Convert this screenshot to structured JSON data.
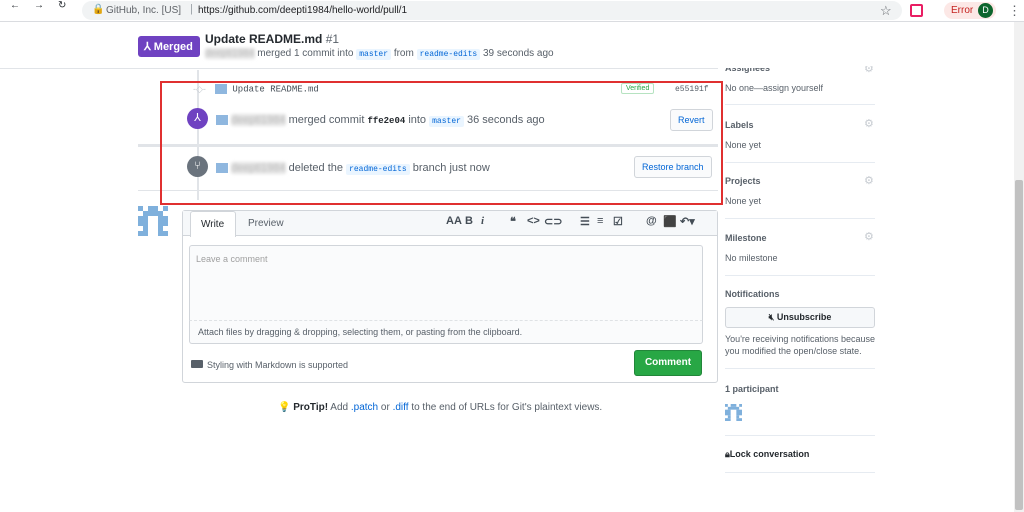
{
  "browser": {
    "back": "←",
    "forward": "→",
    "reload": "↻",
    "site_label": "GitHub, Inc. [US]",
    "url": "https://github.com/deepti1984/hello-world/pull/1",
    "error_label": "Error",
    "profile_initial": "D"
  },
  "pr": {
    "badge": "Merged",
    "title": "Update README.md",
    "number": "#1",
    "author": "deepti1984",
    "merge_text": "merged 1 commit into",
    "base": "master",
    "from": "from",
    "head": "readme-edits",
    "time": "39 seconds ago"
  },
  "timeline": {
    "commit": {
      "message": "Update README.md",
      "verified": "Verified",
      "sha": "e55191f"
    },
    "merged_event": {
      "user": "deepti1984",
      "text": "merged commit",
      "sha": "ffe2e04",
      "into": "into",
      "branch": "master",
      "time": "36 seconds ago",
      "button": "Revert"
    },
    "deleted_event": {
      "user": "deepti1984",
      "text": "deleted the",
      "branch": "readme-edits",
      "time": "branch just now",
      "button": "Restore branch"
    }
  },
  "comment": {
    "tab_write": "Write",
    "tab_preview": "Preview",
    "placeholder": "Leave a comment",
    "attach": "Attach files by dragging & dropping, selecting them, or pasting from the clipboard.",
    "markdown": "Styling with Markdown is supported",
    "submit": "Comment"
  },
  "protip": {
    "label": "ProTip!",
    "t1": "Add",
    "patch": ".patch",
    "t2": "or",
    "diff": ".diff",
    "t3": "to the end of URLs for Git's plaintext views."
  },
  "sidebar": {
    "assignees_label": "Assignees",
    "assignees_value": "No one—assign yourself",
    "labels_label": "Labels",
    "labels_value": "None yet",
    "projects_label": "Projects",
    "projects_value": "None yet",
    "milestone_label": "Milestone",
    "milestone_value": "No milestone",
    "notifications_label": "Notifications",
    "unsubscribe": "Unsubscribe",
    "notif_note1": "You're receiving notifications because",
    "notif_note2": "you modified the open/close state.",
    "participants": "1 participant",
    "lock": "Lock conversation"
  },
  "colors": {
    "merged": "#6f42c1",
    "comment_button": "#28a745",
    "highlight_box": "#e03030",
    "link": "#0366d6"
  }
}
